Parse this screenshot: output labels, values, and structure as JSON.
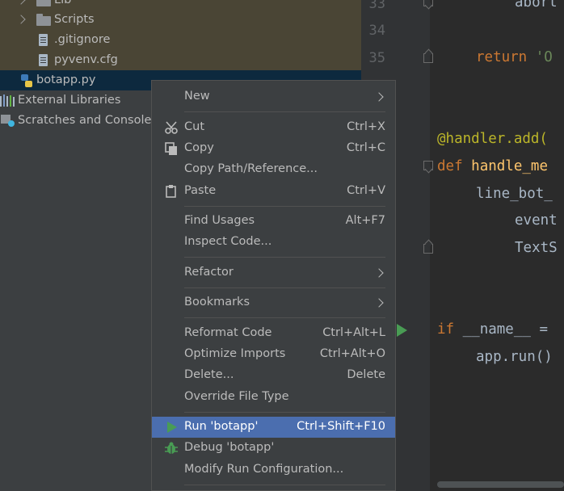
{
  "project_tree": {
    "items": [
      {
        "label": "Lib"
      },
      {
        "label": "Scripts"
      },
      {
        "label": ".gitignore"
      },
      {
        "label": "pyvenv.cfg"
      },
      {
        "label": "botapp.py"
      },
      {
        "label": "External Libraries"
      },
      {
        "label": "Scratches and Consoles"
      }
    ]
  },
  "editor": {
    "line_numbers": [
      "33",
      "34",
      "35"
    ],
    "code": {
      "l1": "abort",
      "l2_kw": "return",
      "l2_str": "'O",
      "l3_dec": "@handler.add(",
      "l4_kw": "def",
      "l4_fn": "handle_me",
      "l5": "line_bot_",
      "l6": "event",
      "l7": "TextS",
      "l8_kw": "if",
      "l8_rest": "__name__ =",
      "l9": "app.run()"
    }
  },
  "context_menu": {
    "new": "New",
    "cut": "Cut",
    "cut_sc": "Ctrl+X",
    "copy": "Copy",
    "copy_sc": "Ctrl+C",
    "copy_path": "Copy Path/Reference...",
    "paste": "Paste",
    "paste_sc": "Ctrl+V",
    "find_usages": "Find Usages",
    "find_usages_sc": "Alt+F7",
    "inspect_code": "Inspect Code...",
    "refactor": "Refactor",
    "bookmarks": "Bookmarks",
    "reformat_code": "Reformat Code",
    "reformat_code_sc": "Ctrl+Alt+L",
    "optimize_imports": "Optimize Imports",
    "optimize_imports_sc": "Ctrl+Alt+O",
    "delete": "Delete...",
    "delete_sc": "Delete",
    "override_file_type": "Override File Type",
    "run": "Run 'botapp'",
    "run_sc": "Ctrl+Shift+F10",
    "debug": "Debug 'botapp'",
    "modify_run_config": "Modify Run Configuration..."
  },
  "colors": {
    "menu_bg": "#3c3f41",
    "highlight": "#4b6eaf",
    "run_green": "#499c54"
  }
}
